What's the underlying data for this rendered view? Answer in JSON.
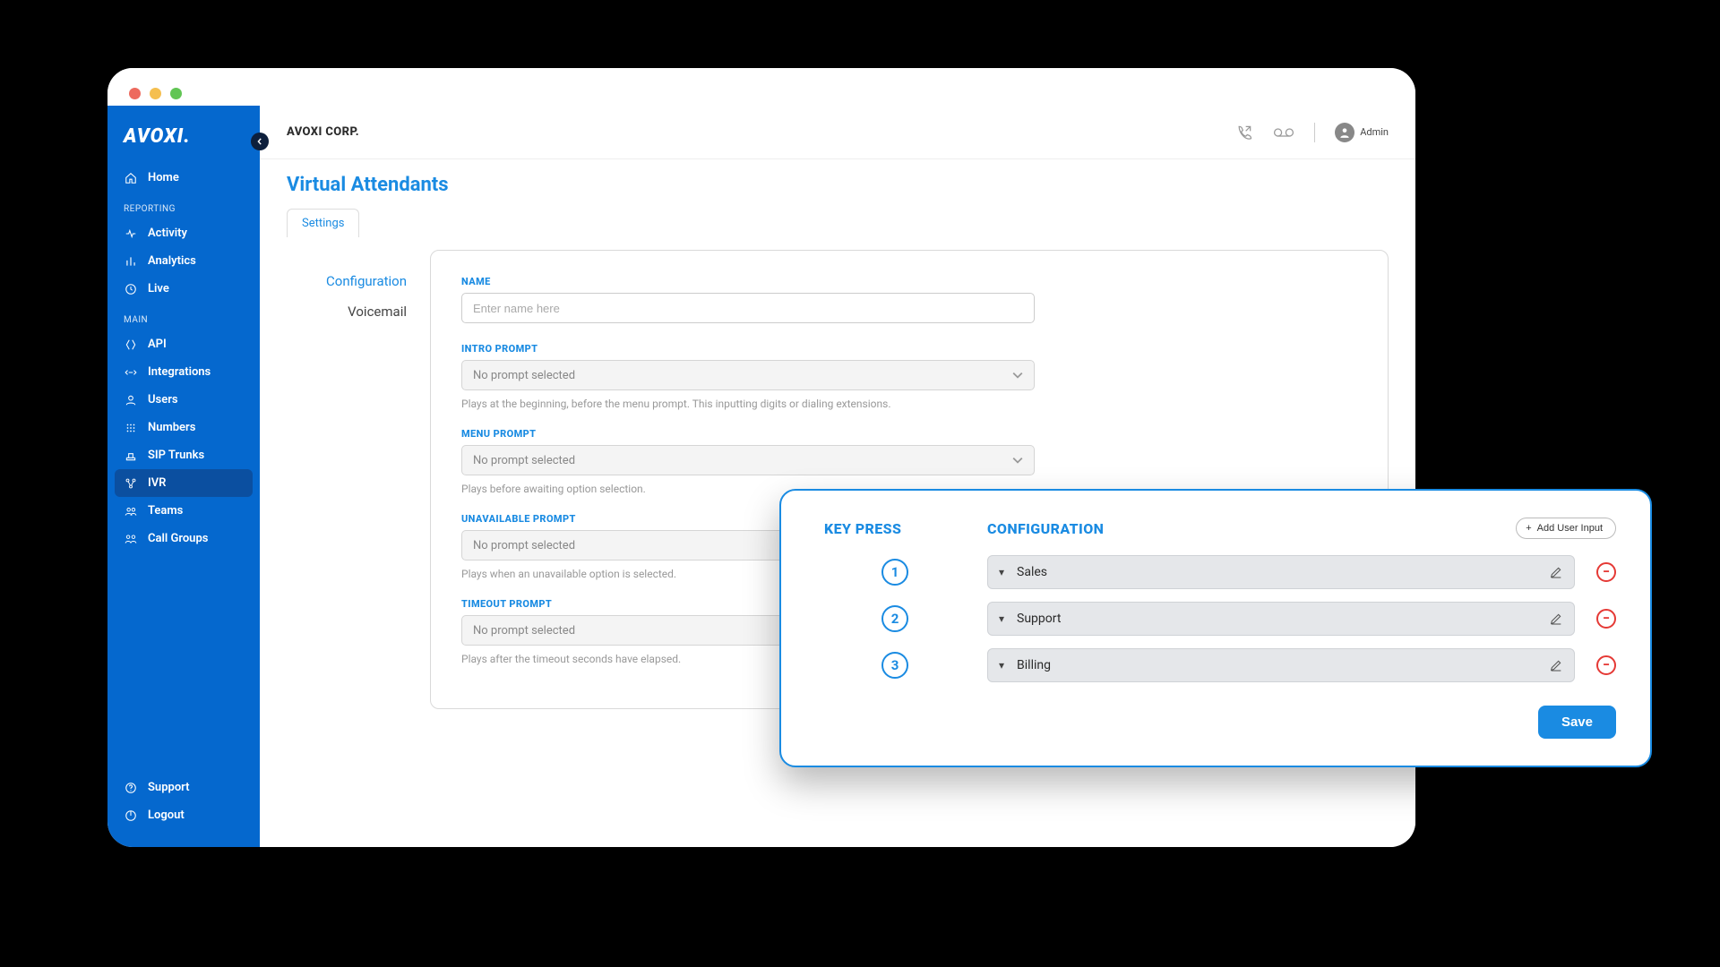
{
  "logo": "AVOXI.",
  "topbar": {
    "org": "AVOXI CORP.",
    "user_role": "Admin"
  },
  "sidebar": {
    "home": "Home",
    "section_reporting": "REPORTING",
    "section_main": "MAIN",
    "reporting": [
      {
        "label": "Activity"
      },
      {
        "label": "Analytics"
      },
      {
        "label": "Live"
      }
    ],
    "main": [
      {
        "label": "API"
      },
      {
        "label": "Integrations"
      },
      {
        "label": "Users"
      },
      {
        "label": "Numbers"
      },
      {
        "label": "SIP Trunks"
      },
      {
        "label": "IVR",
        "active": true
      },
      {
        "label": "Teams"
      },
      {
        "label": "Call Groups"
      }
    ],
    "footer": {
      "support": "Support",
      "logout": "Logout"
    }
  },
  "page": {
    "title": "Virtual Attendants",
    "tab_settings": "Settings",
    "subnav": {
      "configuration": "Configuration",
      "voicemail": "Voicemail"
    },
    "fields": {
      "name_label": "NAME",
      "name_placeholder": "Enter name here",
      "intro_label": "INTRO PROMPT",
      "intro_value": "No prompt selected",
      "intro_help": "Plays at the beginning, before the menu prompt. This inputting digits or dialing extensions.",
      "menu_label": "MENU PROMPT",
      "menu_value": "No prompt selected",
      "menu_help": "Plays before awaiting option selection.",
      "unavail_label": "UNAVAILABLE PROMPT",
      "unavail_value": "No prompt selected",
      "unavail_help": "Plays when an unavailable option is selected.",
      "timeout_label": "TIMEOUT PROMPT",
      "timeout_value": "No prompt selected",
      "timeout_help": "Plays after the timeout seconds have elapsed."
    }
  },
  "panel": {
    "heading_key": "KEY PRESS",
    "heading_conf": "CONFIGURATION",
    "add_label": "Add User Input",
    "save_label": "Save",
    "rows": [
      {
        "key": "1",
        "label": "Sales"
      },
      {
        "key": "2",
        "label": "Support"
      },
      {
        "key": "3",
        "label": "Billing"
      }
    ]
  }
}
